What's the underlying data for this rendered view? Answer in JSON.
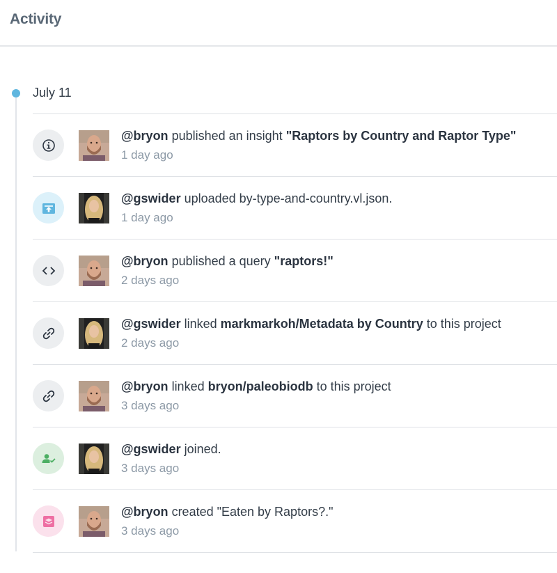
{
  "header": {
    "title": "Activity"
  },
  "timeline": {
    "date": "July 11",
    "colors": {
      "dot": "#5fb6df",
      "line": "#e2e5ea"
    },
    "items": [
      {
        "icon": "info-icon",
        "avatar": "bryon",
        "user": "@bryon",
        "action": " published an insight ",
        "target": "\"Raptors by Country and Raptor Type\"",
        "suffix": "",
        "time": "1 day ago"
      },
      {
        "icon": "upload-icon",
        "avatar": "gswider",
        "user": "@gswider",
        "action": " uploaded by-type-and-country.vl.json.",
        "target": "",
        "suffix": "",
        "time": "1 day ago"
      },
      {
        "icon": "code-icon",
        "avatar": "bryon",
        "user": "@bryon",
        "action": " published a query ",
        "target": "\"raptors!\"",
        "suffix": "",
        "time": "2 days ago"
      },
      {
        "icon": "link-icon",
        "avatar": "gswider",
        "user": "@gswider",
        "action": " linked ",
        "target": "markmarkoh/Metadata by Country",
        "suffix": " to this project",
        "time": "2 days ago"
      },
      {
        "icon": "link-icon",
        "avatar": "bryon",
        "user": "@bryon",
        "action": " linked ",
        "target": "bryon/paleobiodb",
        "suffix": " to this project",
        "time": "3 days ago"
      },
      {
        "icon": "user-check-icon",
        "avatar": "gswider",
        "user": "@gswider",
        "action": " joined.",
        "target": "",
        "suffix": "",
        "time": "3 days ago"
      },
      {
        "icon": "layers-icon",
        "avatar": "bryon",
        "user": "@bryon",
        "action": " created \"Eaten by Raptors?.\"",
        "target": "",
        "suffix": "",
        "time": "3 days ago"
      }
    ]
  }
}
